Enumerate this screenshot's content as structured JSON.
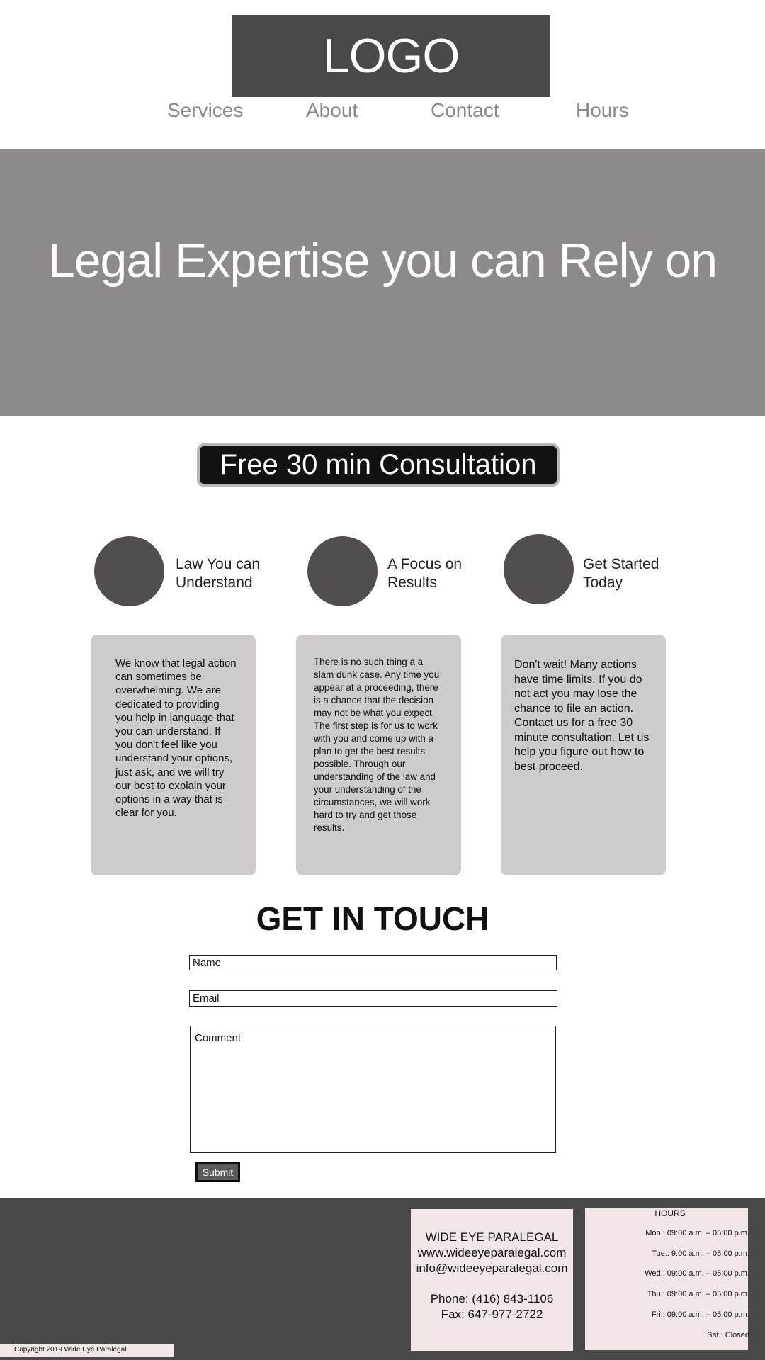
{
  "header": {
    "logo": "LOGO"
  },
  "nav": [
    {
      "label": "Services"
    },
    {
      "label": "About"
    },
    {
      "label": "Contact"
    },
    {
      "label": "Hours"
    }
  ],
  "hero": {
    "headline": "Legal Expertise you can Rely on"
  },
  "cta": {
    "label": "Free 30 min Consultation"
  },
  "features": [
    {
      "title": "Law You can Understand",
      "body": "We know that legal action can sometimes be overwhelming. We are dedicated to providing you help in language that you can understand. If you don't feel like you understand your options, just ask, and we will try our best to explain your options in a way that is clear for you."
    },
    {
      "title": "A Focus on Results",
      "body": " There is no such thing a a slam dunk case.  Any time you appear at a proceeding, there is a chance that the decision may not be what you expect. The first step is for us to work with you and come up with a plan to get the best results possible. Through our understanding of the law and your understanding of the circumstances, we will work hard to try and get those results."
    },
    {
      "title": "Get Started Today",
      "body": " Don't wait! Many actions have time limits.  If you do not act you may lose the chance to file an action. Contact us for a free 30 minute consultation. Let us help you figure out how to best proceed."
    }
  ],
  "contact_form": {
    "title": "GET IN TOUCH",
    "name_placeholder": "Name",
    "email_placeholder": "Email",
    "comment_placeholder": "Comment",
    "submit_label": "Submit"
  },
  "footer": {
    "copyright": "Copyright 2019 Wide Eye Paralegal",
    "company": "WIDE EYE PARALEGAL",
    "website": "www.wideeyeparalegal.com",
    "email": "info@wideeyeparalegal.com",
    "phone": "Phone: (416) 843-1106",
    "fax": "Fax: 647-977-2722",
    "hours_title": "HOURS",
    "hours": [
      "Mon.: 09:00 a.m. – 05:00 p.m.",
      "Tue.:  9:00 a.m. – 05:00 p.m.",
      "Wed.: 09:00 a.m. – 05:00 p.m.",
      "Thu.: 09:00 a.m. – 05:00 p.m.",
      "Fri.: 09:00 a.m. – 05:00 p.m.",
      "Sat.: Closed"
    ]
  },
  "colors": {
    "logo_bg": "#4a494a",
    "nav_text": "#8d8889",
    "hero_bg": "#8e8a8b",
    "cta_bg": "#121212",
    "feature_circle": "#524e4f",
    "card_bg": "#cfcacb",
    "footer_bg": "#4a494a",
    "footer_box_bg": "#f1e7e7"
  }
}
